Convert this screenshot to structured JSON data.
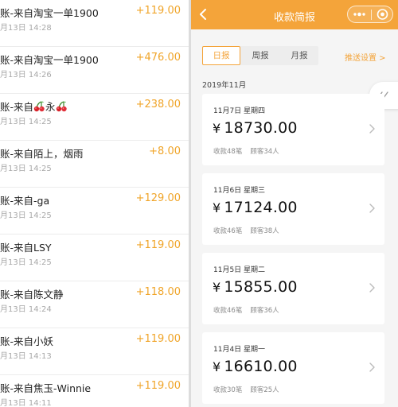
{
  "transactions": [
    {
      "description": "账-来自淘宝一单1900",
      "time": "月13日 14:28",
      "amount": "+119.00"
    },
    {
      "description": "账-来自淘宝一单1900",
      "time": "月13日 14:26",
      "amount": "+476.00"
    },
    {
      "description": "账-来自",
      "description_suffix": "永",
      "time": "月13日 14:25",
      "amount": "+238.00",
      "icons": [
        "cherry-icon",
        "cherry-icon"
      ]
    },
    {
      "description": "账-来自陌上，烟雨",
      "time": "月13日 14:25",
      "amount": "+8.00"
    },
    {
      "description": "账-来自-ga",
      "time": "月13日 14:25",
      "amount": "+129.00"
    },
    {
      "description": "账-来自LSY",
      "time": "月13日 14:25",
      "amount": "+119.00"
    },
    {
      "description": "账-来自陈文静",
      "time": "月13日 14:24",
      "amount": "+118.00"
    },
    {
      "description": "账-来自小妖",
      "time": "月13日 14:13",
      "amount": "+119.00"
    },
    {
      "description": "账-来自焦玉-Winnie",
      "time": "月13日 14:11",
      "amount": "+119.00"
    }
  ],
  "app": {
    "title": "收款简报",
    "tabs": [
      {
        "label": "日报",
        "active": true
      },
      {
        "label": "周报",
        "active": false
      },
      {
        "label": "月报",
        "active": false
      }
    ],
    "push_setting": "推送设置 >",
    "month": "2019年11月",
    "currency_symbol": "¥",
    "daily_reports": [
      {
        "date": "11月7日 星期四",
        "total": "18730.00",
        "count_text": "收款48笔",
        "customers_text": "顾客34人"
      },
      {
        "date": "11月6日 星期三",
        "total": "17124.00",
        "count_text": "收款46笔",
        "customers_text": "顾客38人"
      },
      {
        "date": "11月5日 星期二",
        "total": "15855.00",
        "count_text": "收款46笔",
        "customers_text": "顾客36人"
      },
      {
        "date": "11月4日 星期一",
        "total": "16610.00",
        "count_text": "收款30笔",
        "customers_text": "顾客25人"
      }
    ]
  },
  "colors": {
    "accent": "#f4a43a",
    "amount": "#f0a52a",
    "background": "#f5f5f5"
  }
}
